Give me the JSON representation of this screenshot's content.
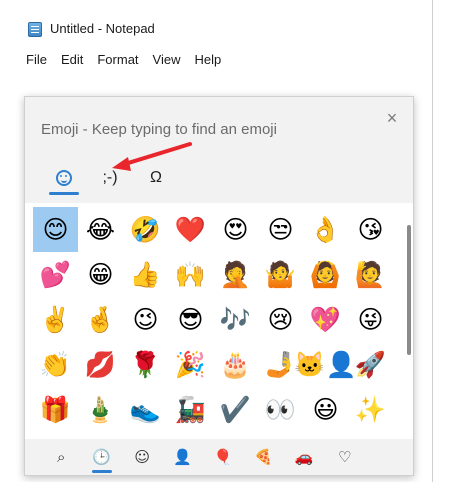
{
  "window": {
    "title": "Untitled - Notepad"
  },
  "menu": [
    "File",
    "Edit",
    "Format",
    "View",
    "Help"
  ],
  "emoji_panel": {
    "search_hint": "Emoji - Keep typing to find an emoji",
    "close_label": "×",
    "tabs": [
      {
        "name": "emoji",
        "label": "",
        "icon": "smiley-icon",
        "active": true
      },
      {
        "name": "kaomoji",
        "label": ";-)",
        "active": false
      },
      {
        "name": "symbols",
        "label": "Ω",
        "active": false
      }
    ],
    "emojis": [
      "😊",
      "😂",
      "🤣",
      "❤️",
      "😍",
      "😒",
      "👌",
      "😘",
      "💕",
      "😁",
      "👍",
      "🙌",
      "🤦",
      "🤷",
      "🙆",
      "🙋",
      "✌️",
      "🤞",
      "😉",
      "😎",
      "🎶",
      "😢",
      "💖",
      "😜",
      "👏",
      "💋",
      "🌹",
      "🎉",
      "🎂",
      "🤳",
      "🐱‍👤",
      "🚀",
      "🎁",
      "🎍",
      "👟",
      "🚂",
      "✔️",
      "👀",
      "😃",
      "✨"
    ],
    "selected_index": 0,
    "categories": [
      {
        "name": "search",
        "glyph": "⌕",
        "active": false
      },
      {
        "name": "recent",
        "glyph": "🕒",
        "active": true
      },
      {
        "name": "smileys",
        "glyph": "☺",
        "active": false
      },
      {
        "name": "people",
        "glyph": "👤",
        "active": false
      },
      {
        "name": "celebrations",
        "glyph": "🎈",
        "active": false
      },
      {
        "name": "food",
        "glyph": "🍕",
        "active": false
      },
      {
        "name": "transport",
        "glyph": "🚗",
        "active": false
      },
      {
        "name": "symbols",
        "glyph": "♡",
        "active": false
      }
    ],
    "annotation_color": "#e8262b"
  }
}
